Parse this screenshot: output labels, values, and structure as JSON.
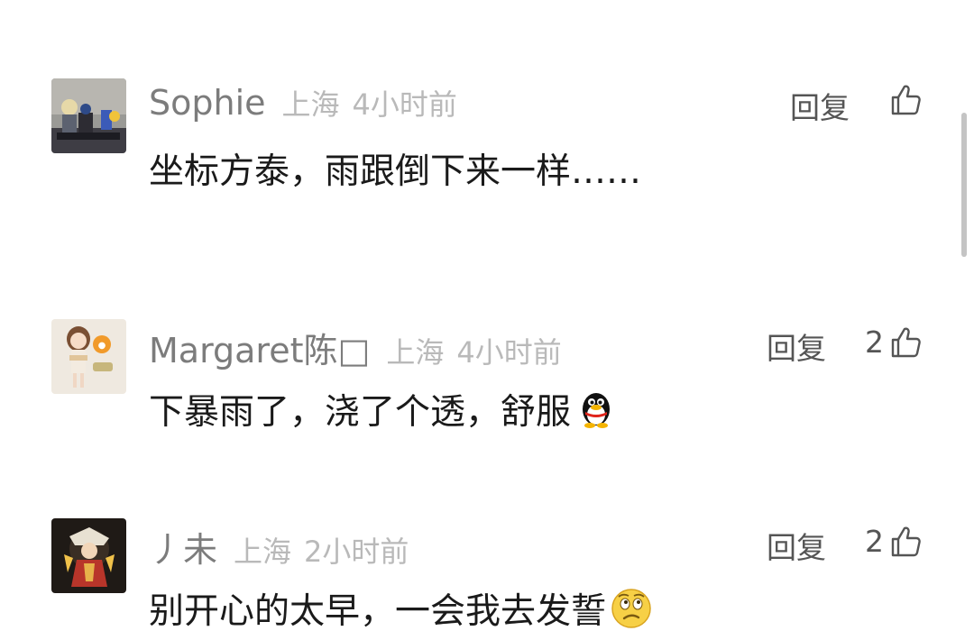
{
  "comments": [
    {
      "username": "Sophie",
      "location": "上海",
      "time": "4小时前",
      "reply_label": "回复",
      "like_count": "",
      "text": "坐标方泰，雨跟倒下来一样……",
      "avatar_icon": "avatar-figurine-icon",
      "emoji_icon": ""
    },
    {
      "username": "Margaret陈□",
      "location": "上海",
      "time": "4小时前",
      "reply_label": "回复",
      "like_count": "2",
      "text": "下暴雨了，浇了个透，舒服",
      "avatar_icon": "avatar-girl-icon",
      "emoji_icon": "penguin-emoji-icon"
    },
    {
      "username": "丿未",
      "location": "上海",
      "time": "2小时前",
      "reply_label": "回复",
      "like_count": "2",
      "text": "别开心的太早，一会我去发誓",
      "avatar_icon": "avatar-game-character-icon",
      "emoji_icon": "worried-face-emoji-icon"
    }
  ],
  "colors": {
    "username": "#7c7c7c",
    "meta": "#b9b9b9",
    "text": "#1a1a1a",
    "action": "#555555"
  }
}
